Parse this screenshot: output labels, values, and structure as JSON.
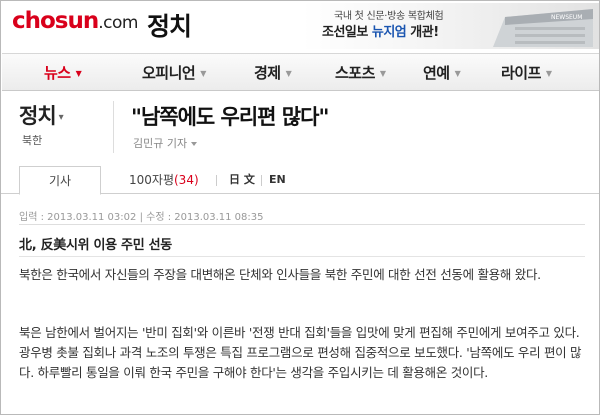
{
  "header": {
    "logo_main": "chosun",
    "logo_suffix": ".com",
    "section_title": "정치",
    "banner": {
      "line1": "국내 첫 신문·방송 복합체험",
      "line2_prefix": "조선일보 ",
      "line2_highlight": "뉴지엄",
      "line2_suffix": " 개관!",
      "building_sign": "NEWSEUM"
    }
  },
  "nav": {
    "items": [
      {
        "label": "뉴스",
        "active": true
      },
      {
        "label": "오피니언",
        "active": false
      },
      {
        "label": "경제",
        "active": false
      },
      {
        "label": "스포츠",
        "active": false
      },
      {
        "label": "연예",
        "active": false
      },
      {
        "label": "라이프",
        "active": false
      }
    ],
    "arrow_glyph": "▼"
  },
  "article": {
    "category": "정치",
    "category_caret": "▾",
    "subcategory": "북한",
    "headline": "\"남쪽에도 우리편 많다\"",
    "byline": "김민규 기자",
    "byline_icon": "dropdown-arrow-icon"
  },
  "tabs": {
    "article_label": "기사",
    "comments_label": "100자평",
    "comments_count": "(34)",
    "lang_ja": "日 文",
    "lang_en": "EN"
  },
  "meta": {
    "published_label": "입력 : 2013.03.11 03:02",
    "updated_label": "수정 : 2013.03.11 08:35"
  },
  "body": {
    "subhead": "北, 反美시위 이용 주민 선동",
    "paragraph1": "북한은 한국에서 자신들의 주장을 대변해온 단체와 인사들을 북한 주민에 대한 선전 선동에 활용해 왔다.",
    "paragraph2": "북은 남한에서 벌어지는 '반미 집회'와 이른바 '전쟁 반대 집회'들을 입맛에 맞게 편집해 주민에게 보여주고 있다. 광우병 촛불 집회나 과격 노조의 투쟁은 특집 프로그램으로 편성해 집중적으로 보도했다. '남쪽에도 우리 편이 많다. 하루빨리 통일을 이뤄 한국 주민을 구해야 한다'는 생각을 주입시키는 데 활용해온 것이다."
  },
  "colors": {
    "brand_red": "#d9001b",
    "banner_blue": "#1a55b0"
  }
}
